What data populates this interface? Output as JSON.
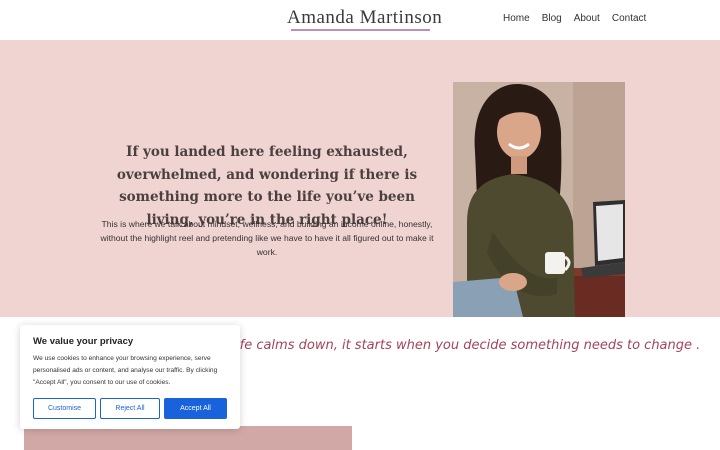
{
  "header": {
    "logo": "Amanda Martinson",
    "nav": [
      "Home",
      "Blog",
      "About",
      "Contact"
    ]
  },
  "hero": {
    "heading": "If you landed here feeling exhausted, overwhelmed, and wondering if there is something more to the life you’ve been living, you’re in the right place!",
    "body": "This is where we talk about mindset, wellness, and building an income online, honestly, without the highlight reel and pretending like we have to have it all figured out to make it work."
  },
  "quote": {
    "text": "ife calms down, it starts when you decide something needs to change ."
  },
  "cookie": {
    "title": "We value your privacy",
    "text": "We use cookies to enhance your browsing experience, serve personalised ads or content, and analyse our traffic. By clicking \"Accept All\", you consent to our use of cookies.",
    "customise": "Customise",
    "reject": "Reject All",
    "accept": "Accept All"
  },
  "colors": {
    "hero_bg": "#f0d4d2",
    "quote": "#a3445a",
    "button_blue": "#1863dc",
    "logo_underline": "#b892b8"
  }
}
